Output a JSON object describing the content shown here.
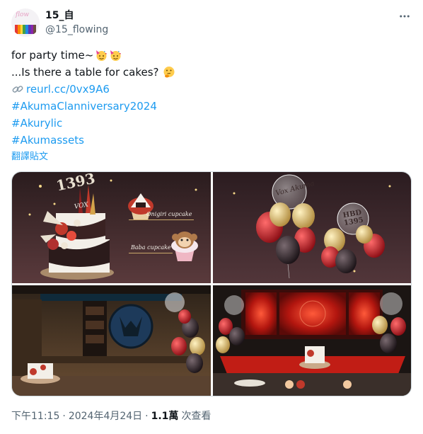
{
  "author": {
    "display_name": "15_自",
    "handle": "@15_flowing",
    "avatar_text": "flow"
  },
  "tweet": {
    "lines": [
      {
        "text": "for party time~",
        "emojis": [
          "partying-face-emoji",
          "partying-face-emoji"
        ]
      },
      {
        "text": "...Is there a table for cakes?",
        "emojis": [
          "thinking-face-emoji"
        ]
      }
    ],
    "link_icon": "link-emoji",
    "link_text": "reurl.cc/0vx9A6",
    "hashtags": [
      "#AkumaClanniversary2024",
      "#Akurylic",
      "#Akumassets"
    ],
    "translate_label": "翻譯貼文"
  },
  "media": {
    "images": [
      {
        "name": "cake-menu-image",
        "labels": [
          "Onigiri cupcake",
          "Baba cupcake"
        ],
        "cake_topper": "1393",
        "cake_logo": "VOX"
      },
      {
        "name": "balloon-bundle-image",
        "balloon_texts": [
          "Vox Akuma",
          "HBD 1395"
        ]
      },
      {
        "name": "room-scene-image"
      },
      {
        "name": "party-stage-image"
      }
    ]
  },
  "meta": {
    "time": "下午11:15",
    "date": "2024年4月24日",
    "views_count": "1.1萬",
    "views_label": "次查看"
  },
  "colors": {
    "link": "#1d9bf0",
    "secondary_text": "#536471",
    "primary_text": "#0f1419",
    "border": "#cfd9de"
  }
}
